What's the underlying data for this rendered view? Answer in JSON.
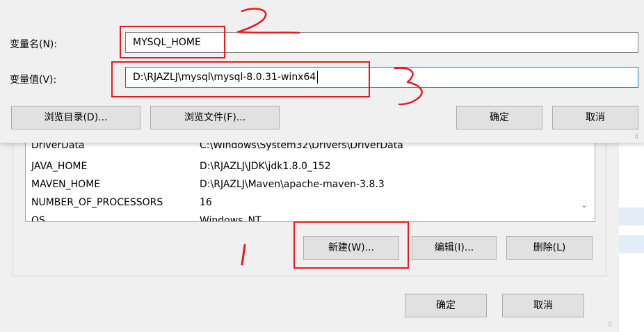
{
  "edit_dialog": {
    "name_label": "变量名(N):",
    "name_value": "MYSQL_HOME",
    "value_label": "变量值(V):",
    "value_value": "D:\\RJAZLJ\\mysql\\mysql-8.0.31-winx64",
    "browse_dir_button": "浏览目录(D)...",
    "browse_file_button": "浏览文件(F)...",
    "ok_button": "确定",
    "cancel_button": "取消"
  },
  "env_list": {
    "rows": [
      {
        "name": "DriverData",
        "value": "C:\\Windows\\System32\\Drivers\\DriverData"
      },
      {
        "name": "JAVA_HOME",
        "value": "D:\\RJAZLJ\\JDK\\jdk1.8.0_152"
      },
      {
        "name": "MAVEN_HOME",
        "value": "D:\\RJAZLJ\\Maven\\apache-maven-3.8.3"
      },
      {
        "name": "NUMBER_OF_PROCESSORS",
        "value": "16"
      },
      {
        "name": "OS",
        "value": "Windows_NT"
      }
    ]
  },
  "env_buttons": {
    "new_button": "新建(W)...",
    "edit_button": "编辑(I)...",
    "delete_button": "删除(L)"
  },
  "bottom_buttons": {
    "ok_button": "确定",
    "cancel_button": "取消"
  },
  "colors": {
    "annotation_red": "#e8191f",
    "focus_blue": "#0078d7",
    "dialog_bg": "#f0f0f0"
  }
}
